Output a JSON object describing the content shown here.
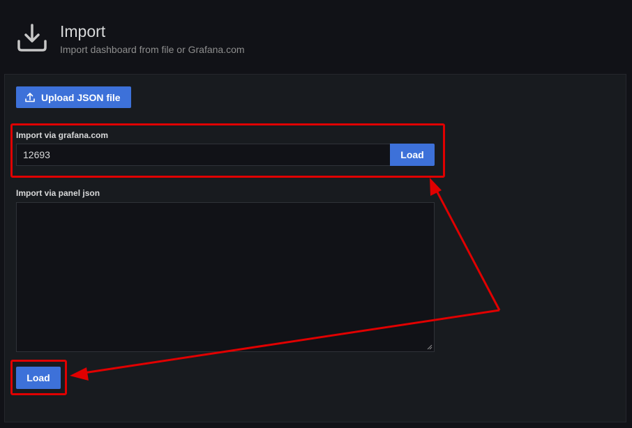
{
  "header": {
    "title": "Import",
    "subtitle": "Import dashboard from file or Grafana.com",
    "icon": "download-icon"
  },
  "upload": {
    "label": "Upload JSON file",
    "icon": "upload-icon"
  },
  "grafana_com": {
    "label": "Import via grafana.com",
    "value": "12693",
    "load_label": "Load"
  },
  "panel_json": {
    "label": "Import via panel json",
    "value": ""
  },
  "bottom": {
    "load_label": "Load"
  },
  "colors": {
    "accent": "#3d71d9",
    "annotation": "#e00000",
    "background": "#111217",
    "panel": "#181b1f"
  }
}
